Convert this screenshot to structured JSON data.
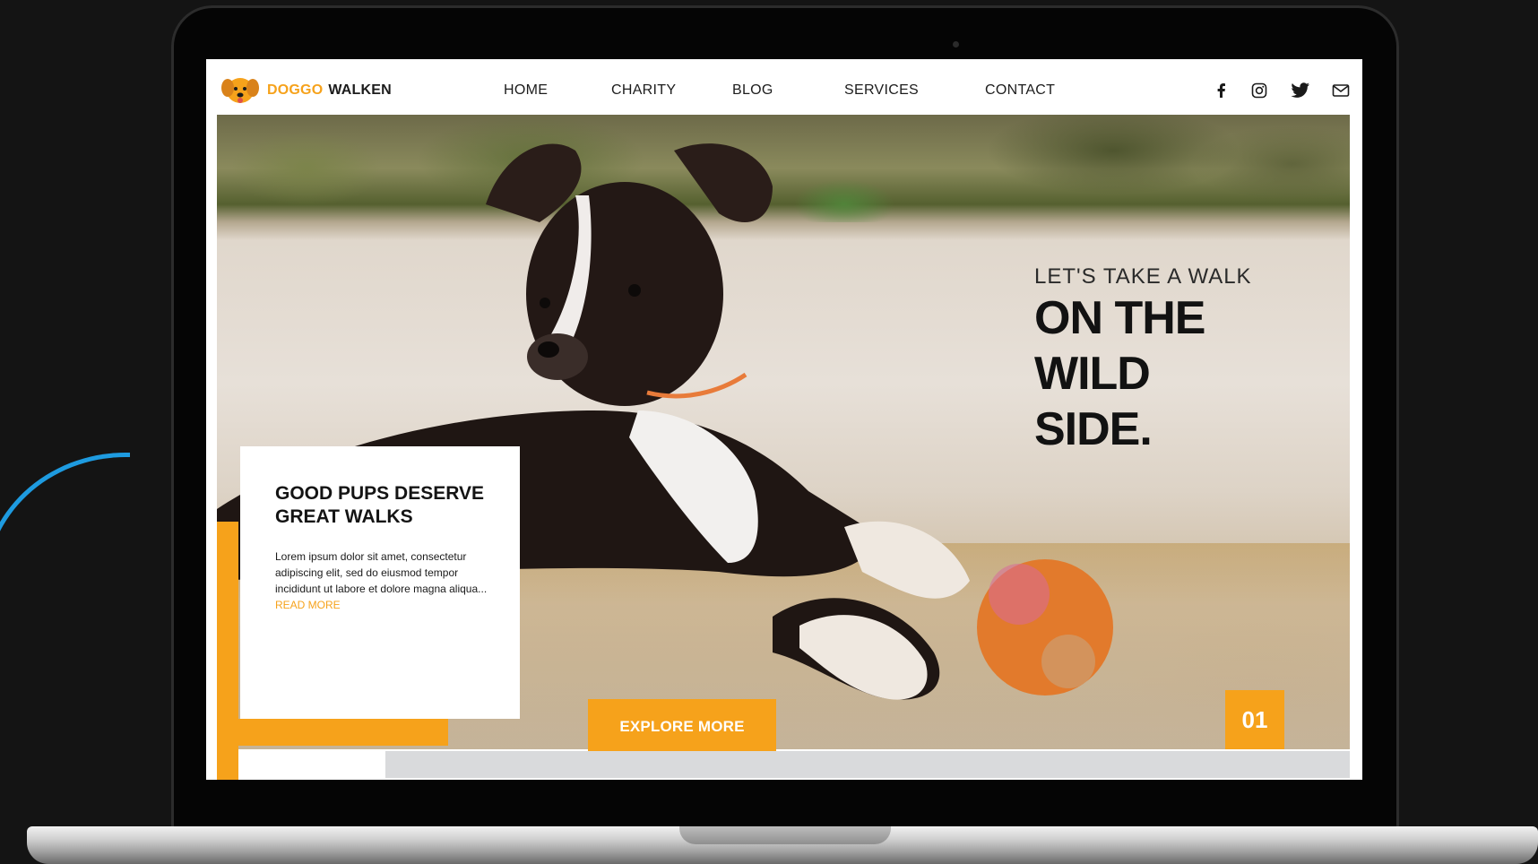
{
  "colors": {
    "accent": "#f6a21b",
    "text_dark": "#1c1c1c",
    "background": "#141414",
    "deco_arc": "#1e9be0"
  },
  "brand": {
    "logo_icon": "dog-face-icon",
    "name_part1": "DOGGO",
    "name_part2": "WALKEN"
  },
  "nav": {
    "items": [
      {
        "label": "HOME"
      },
      {
        "label": "CHARITY"
      },
      {
        "label": "BLOG"
      },
      {
        "label": "SERVICES"
      },
      {
        "label": "CONTACT"
      }
    ],
    "social_icons": [
      "facebook-icon",
      "instagram-icon",
      "twitter-icon",
      "mail-icon"
    ]
  },
  "hero": {
    "tagline": "LET'S TAKE A WALK",
    "headline_lines": [
      "ON THE",
      "WILD",
      "SIDE."
    ],
    "slide_number": "01",
    "image_description_icon": "puppy-photo"
  },
  "card": {
    "title": "GOOD PUPS DESERVE GREAT WALKS",
    "body": "Lorem ipsum dolor sit amet, consectetur adipiscing elit, sed do eiusmod tempor incididunt ut labore et dolore magna aliqua...",
    "read_more": "READ MORE",
    "button": "EXPLORE MORE"
  }
}
